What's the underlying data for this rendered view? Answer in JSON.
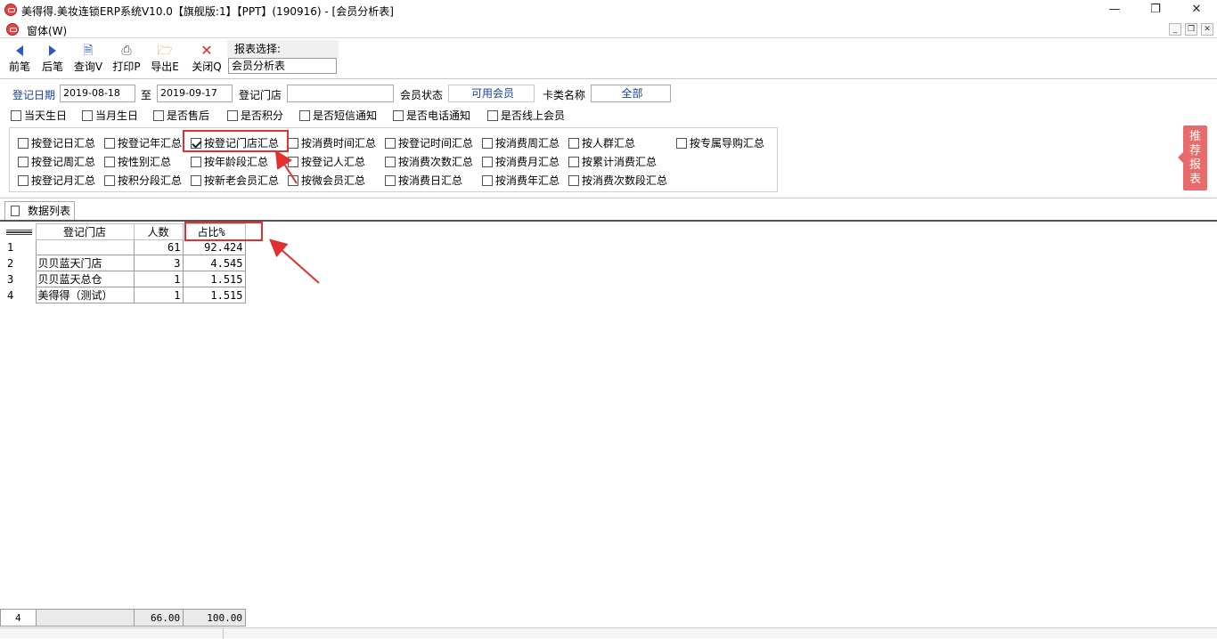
{
  "window": {
    "title": "美得得.美妆连锁ERP系统V10.0【旗舰版:1】【PPT】(190916) - [会员分析表]",
    "menu": "窗体(W)"
  },
  "toolbar": {
    "prev": "前笔",
    "next": "后笔",
    "query": "查询V",
    "print": "打印P",
    "export": "导出E",
    "close": "关闭Q",
    "report_label": "报表选择:",
    "report_value": "会员分析表"
  },
  "filters": {
    "reg_date_label": "登记日期",
    "date_from": "2019-08-18",
    "to_label": "至",
    "date_to": "2019-09-17",
    "store_label": "登记门店",
    "store_value": "",
    "member_status_label": "会员状态",
    "member_status_value": "可用会员",
    "card_type_label": "卡类名称",
    "card_type_value": "全部"
  },
  "options": [
    "当天生日",
    "当月生日",
    "是否售后",
    "是否积分",
    "是否短信通知",
    "是否电话通知",
    "是否线上会员"
  ],
  "groups": {
    "row1": [
      "按登记日汇总",
      "按登记年汇总",
      "按登记门店汇总",
      "按消费时间汇总",
      "按登记时间汇总",
      "按消费周汇总",
      "按人群汇总",
      "按专属导购汇总"
    ],
    "row2": [
      "按登记周汇总",
      "按性别汇总",
      "按年龄段汇总",
      "按登记人汇总",
      "按消费次数汇总",
      "按消费月汇总",
      "按累计消费汇总"
    ],
    "row3": [
      "按登记月汇总",
      "按积分段汇总",
      "按新老会员汇总",
      "按微会员汇总",
      "按消费日汇总",
      "按消费年汇总",
      "按消费次数段汇总"
    ],
    "checked": "按登记门店汇总"
  },
  "recommend": "推荐报表",
  "tab": "数据列表",
  "table": {
    "headers": [
      "登记门店",
      "人数",
      "占比%"
    ],
    "rows": [
      {
        "no": "1",
        "store": "",
        "count": "61",
        "pct": "92.424"
      },
      {
        "no": "2",
        "store": "贝贝蓝天门店",
        "count": "3",
        "pct": "4.545"
      },
      {
        "no": "3",
        "store": "贝贝蓝天总仓",
        "count": "1",
        "pct": "1.515"
      },
      {
        "no": "4",
        "store": "美得得（测试）",
        "count": "1",
        "pct": "1.515"
      }
    ],
    "footer": {
      "rows": "4",
      "count": "66.00",
      "pct": "100.00"
    }
  },
  "colors": {
    "accent": "#e03030",
    "label_blue": "#1a3fa0",
    "recommend_bg": "#e86a6a"
  }
}
